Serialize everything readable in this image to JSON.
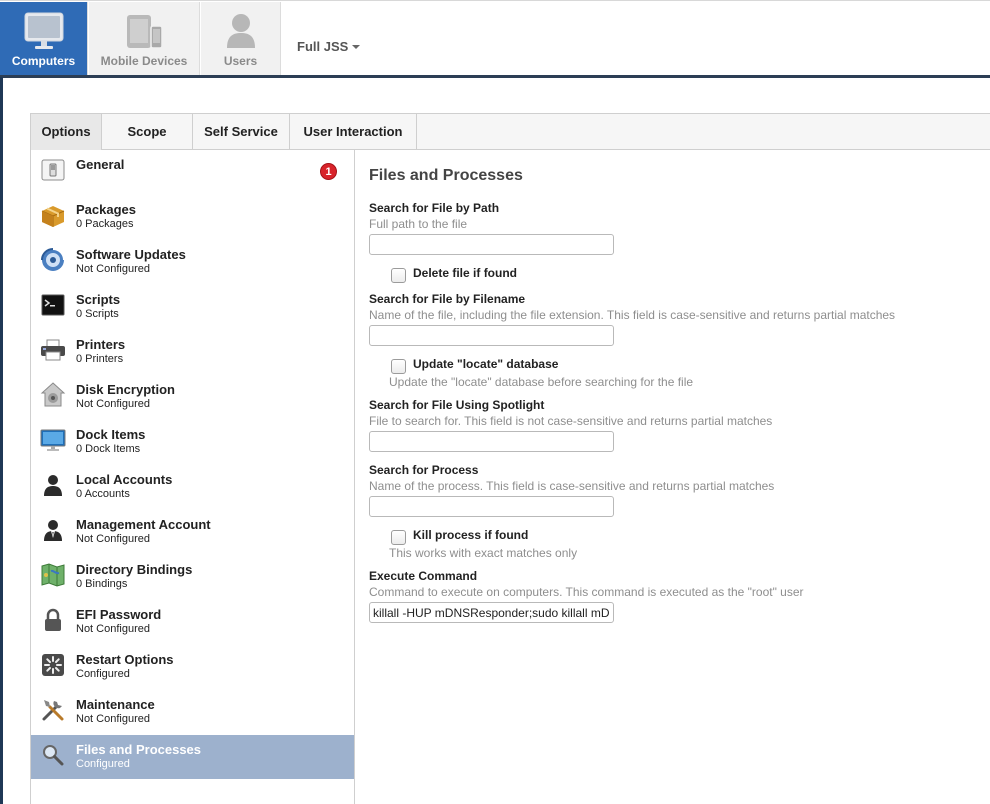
{
  "nav": {
    "tabs": [
      {
        "label": "Computers",
        "icon": "computer-icon",
        "active": true
      },
      {
        "label": "Mobile Devices",
        "icon": "mobile-devices-icon",
        "active": false
      },
      {
        "label": "Users",
        "icon": "user-icon",
        "active": false
      }
    ],
    "site_selector": "Full JSS"
  },
  "tabs": [
    {
      "label": "Options",
      "active": true
    },
    {
      "label": "Scope",
      "active": false
    },
    {
      "label": "Self Service",
      "active": false
    },
    {
      "label": "User Interaction",
      "active": false
    }
  ],
  "sidebar": {
    "items": [
      {
        "title": "General",
        "subtitle": "",
        "icon": "general-switch-icon",
        "badge": "1"
      },
      {
        "title": "Packages",
        "subtitle": "0 Packages",
        "icon": "package-box-icon"
      },
      {
        "title": "Software Updates",
        "subtitle": "Not Configured",
        "icon": "software-update-icon"
      },
      {
        "title": "Scripts",
        "subtitle": "0 Scripts",
        "icon": "terminal-icon"
      },
      {
        "title": "Printers",
        "subtitle": "0 Printers",
        "icon": "printer-icon"
      },
      {
        "title": "Disk Encryption",
        "subtitle": "Not Configured",
        "icon": "disk-encryption-icon"
      },
      {
        "title": "Dock Items",
        "subtitle": "0 Dock Items",
        "icon": "dock-display-icon"
      },
      {
        "title": "Local Accounts",
        "subtitle": "0 Accounts",
        "icon": "local-account-icon"
      },
      {
        "title": "Management Account",
        "subtitle": "Not Configured",
        "icon": "management-account-icon"
      },
      {
        "title": "Directory Bindings",
        "subtitle": "0 Bindings",
        "icon": "directory-map-icon"
      },
      {
        "title": "EFI Password",
        "subtitle": "Not Configured",
        "icon": "padlock-icon"
      },
      {
        "title": "Restart Options",
        "subtitle": "Configured",
        "icon": "restart-spinner-icon"
      },
      {
        "title": "Maintenance",
        "subtitle": "Not Configured",
        "icon": "tools-icon"
      },
      {
        "title": "Files and Processes",
        "subtitle": "Configured",
        "icon": "magnifier-icon",
        "selected": true
      }
    ]
  },
  "form": {
    "title": "Files and Processes",
    "search_path": {
      "label": "Search for File by Path",
      "help": "Full path to the file",
      "value": ""
    },
    "delete_file": {
      "label": "Delete file if found",
      "checked": false
    },
    "search_filename": {
      "label": "Search for File by Filename",
      "help": "Name of the file, including the file extension. This field is case-sensitive and returns partial matches",
      "value": ""
    },
    "update_locate": {
      "label": "Update \"locate\" database",
      "help": "Update the \"locate\" database before searching for the file",
      "checked": false
    },
    "search_spotlight": {
      "label": "Search for File Using Spotlight",
      "help": "File to search for. This field is not case-sensitive and returns partial matches",
      "value": ""
    },
    "search_process": {
      "label": "Search for Process",
      "help": "Name of the process. This field is case-sensitive and returns partial matches",
      "value": ""
    },
    "kill_process": {
      "label": "Kill process if found",
      "help": "This works with exact matches only",
      "checked": false
    },
    "execute_command": {
      "label": "Execute Command",
      "help": "Command to execute on computers. This command is executed as the \"root\" user",
      "value": "killall -HUP mDNSResponder;sudo killall mDNSResponderHelper"
    }
  },
  "colors": {
    "nav_active": "#2f6bb6",
    "nav_rule": "#2c3e55",
    "sidebar_selected": "#9db1cd",
    "badge": "#d8232a"
  }
}
